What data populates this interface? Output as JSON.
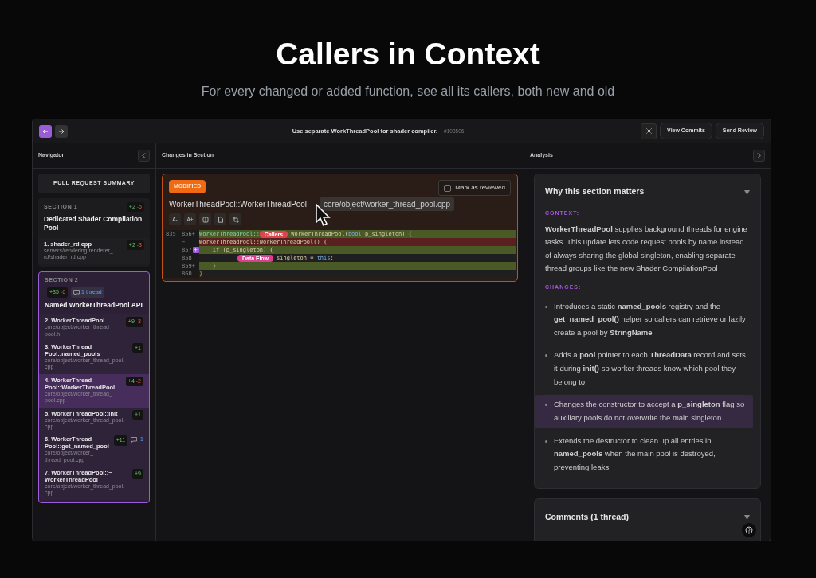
{
  "hero": {
    "title": "Callers in Context",
    "subtitle": "For every changed or added function, see all its callers, both new and old"
  },
  "toolbar": {
    "title": "Use separate WorkThreadPool for shader compiler.",
    "pr_number": "#103506",
    "buttons": [
      "View Commits",
      "Send Review"
    ]
  },
  "navigator": {
    "title": "Navigator",
    "summary": "PULL REQUEST SUMMARY",
    "sections": [
      {
        "label": "SECTION 1",
        "title": "Dedicated Shader Compilation Pool",
        "adds": "+2",
        "dels": "-5",
        "selected": false,
        "items": [
          {
            "name": "1. shader_rd.cpp",
            "path": "servers/rendering/renderer_ rd/shader_rd.cpp",
            "adds": "+2",
            "dels": "-3",
            "selected": false
          }
        ]
      },
      {
        "label": "SECTION 2",
        "title": "Named WorkerThreadPool API",
        "adds": "+35",
        "dels": "-6",
        "threads": "1 thread",
        "selected": true,
        "items": [
          {
            "name": "2. WorkerThreadPool",
            "path": "core/object/worker_thread_ pool.h",
            "adds": "+9",
            "dels": "-3",
            "selected": false
          },
          {
            "name": "3. WorkerThread Pool::named_pools",
            "path": "core/object/worker_thread_pool. cpp",
            "adds": "+1",
            "selected": false
          },
          {
            "name": "4. WorkerThread Pool::WorkerThreadPool",
            "path": "core/object/worker_thread_ pool.cpp",
            "adds": "+4",
            "dels": "-2",
            "selected": true
          },
          {
            "name": "5. WorkerThreadPool::init",
            "path": "core/object/worker_thread_pool. cpp",
            "adds": "+1",
            "selected": false
          },
          {
            "name": "6. WorkerThread Pool::get_named_pool",
            "path": "core/object/worker_ thread_pool.cpp",
            "adds": "+11",
            "comments": "1",
            "selected": false
          },
          {
            "name": "7. WorkerThreadPool::~ WorkerThreadPool",
            "path": "core/object/worker_thread_pool. cpp",
            "adds": "+9",
            "selected": false
          }
        ]
      }
    ]
  },
  "changes": {
    "title": "Changes in Section",
    "status": "MODIFIED",
    "mark_reviewed": {
      "label": "Mark as reviewed",
      "checked": false
    },
    "function": "WorkerThreadPool::WorkerThreadPool",
    "file": "core/object/worker_thread_pool.cpp",
    "tools": [
      "A-",
      "A+"
    ],
    "lines": [
      {
        "old": "835",
        "new": "856+",
        "kind": "add",
        "tokens": [
          {
            "t": "WorkerThreadPool::",
            "kind": "name"
          },
          {
            "t": "Callers",
            "kind": "callers"
          },
          {
            "t": "WorkerThreadPool(",
            "kind": "plain"
          },
          {
            "t": "bool",
            "kind": "type"
          },
          {
            "t": " p_singleton) {",
            "kind": "plain"
          }
        ]
      },
      {
        "new": "−",
        "kind": "del",
        "tokens": [
          {
            "t": "WorkerThreadPool::WorkerThreadPool() {",
            "kind": "plain"
          }
        ]
      },
      {
        "new": "857",
        "kind": "add",
        "comment_button": "+",
        "tokens": [
          {
            "t": "    if (p_singleton) {",
            "kind": "plain"
          }
        ]
      },
      {
        "new": "858",
        "kind": "ctx",
        "tokens": [
          {
            "t": "Data Flow",
            "kind": "dataflow"
          },
          {
            "t": "singleton = ",
            "kind": "plain"
          },
          {
            "t": "this",
            "kind": "type"
          },
          {
            "t": ";",
            "kind": "plain"
          }
        ]
      },
      {
        "new": "859+",
        "kind": "add",
        "tokens": [
          {
            "t": "    }",
            "kind": "plain"
          }
        ]
      },
      {
        "new": "860",
        "kind": "ctx",
        "tokens": [
          {
            "t": "}",
            "kind": "brace"
          }
        ]
      }
    ]
  },
  "analysis": {
    "title": "Analysis",
    "why": {
      "title": "Why this section matters",
      "expanded": true,
      "context_label": "CONTEXT:",
      "context": "**WorkerThreadPool** supplies background threads for engine tasks. This update lets code request pools by name instead of always sharing the global singleton, enabling separate thread groups like the new Shader CompilationPool",
      "changes_label": "CHANGES:",
      "changes": [
        {
          "text": "Introduces a static **named_pools** registry and the **get_named_pool()** helper so callers can retrieve or lazily create a pool by **StringName**",
          "selected": false
        },
        {
          "text": "Adds a **pool** pointer to each **ThreadData** record and sets it during **init()** so worker threads know which pool they belong to",
          "selected": false
        },
        {
          "text": "Changes the constructor to accept a **p_singleton** flag so auxiliary pools do not overwrite the main singleton",
          "selected": true
        },
        {
          "text": "Extends the destructor to clean up all entries in **named_pools** when the main pool is destroyed, preventing leaks",
          "selected": false
        }
      ]
    },
    "comments": {
      "title": "Comments (1 thread)",
      "expanded": true
    }
  }
}
